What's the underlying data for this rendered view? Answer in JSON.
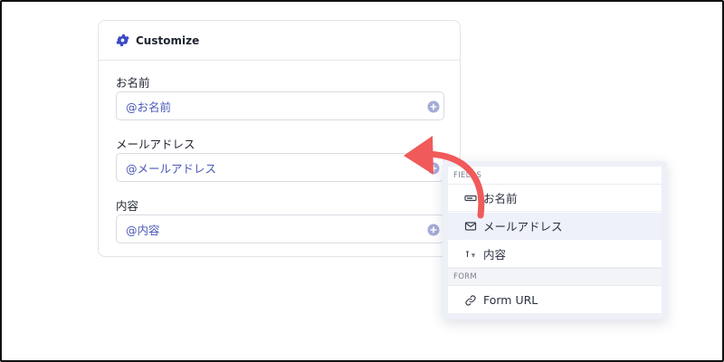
{
  "card": {
    "title": "Customize",
    "icon": "gear-icon",
    "fields": [
      {
        "label": "お名前",
        "value": "@お名前"
      },
      {
        "label": "メールアドレス",
        "value": "@メールアドレス"
      },
      {
        "label": "内容",
        "value": "@内容"
      }
    ]
  },
  "dropdown": {
    "fields_header": "FIELDS",
    "items": [
      {
        "label": "お名前",
        "icon": "text-field-icon"
      },
      {
        "label": "メールアドレス",
        "icon": "mail-icon"
      },
      {
        "label": "内容",
        "icon": "paragraph-icon"
      }
    ],
    "form_header": "FORM",
    "form_items": [
      {
        "label": "Form URL",
        "icon": "link-icon"
      }
    ]
  },
  "colors": {
    "accent": "#4a58b8",
    "arrow": "#f05a5a",
    "gear": "#3b49c6"
  }
}
